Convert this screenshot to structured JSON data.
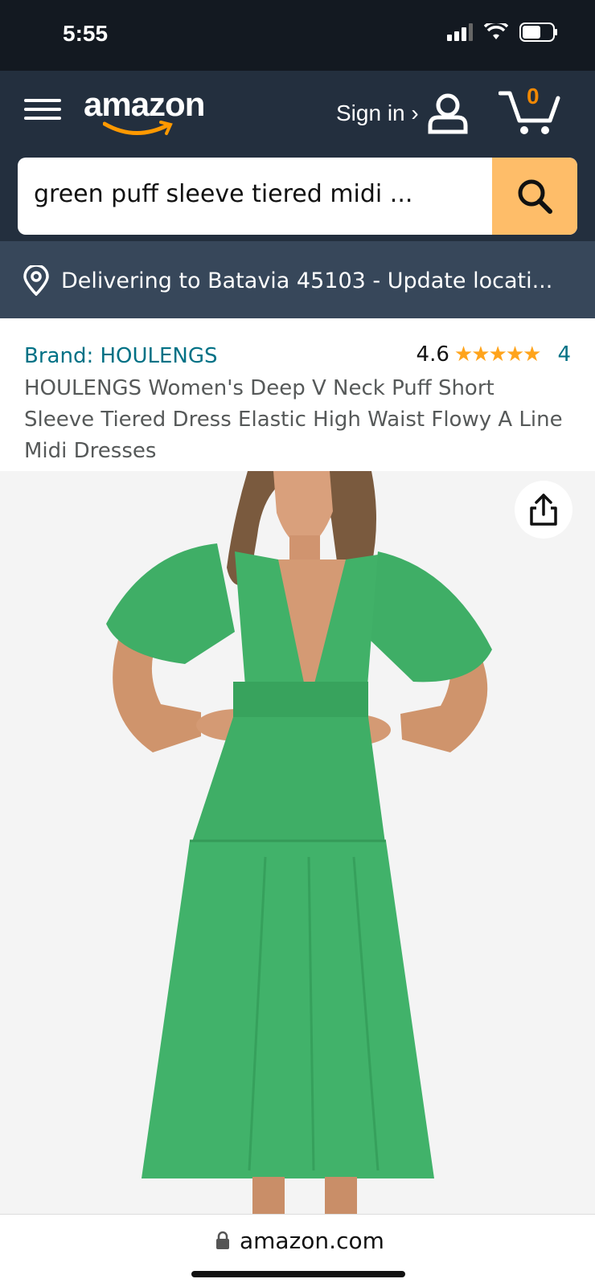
{
  "status": {
    "time": "5:55"
  },
  "header": {
    "logo": "amazon",
    "signin": "Sign in ›",
    "cart_count": "0"
  },
  "search": {
    "query": "green puff sleeve tiered midi ..."
  },
  "delivery": {
    "text": "Delivering to Batavia 45103 - Update locati..."
  },
  "product": {
    "brand": "Brand: HOULENGS",
    "rating": "4.6",
    "stars": "★★★★★",
    "rating_count": "4",
    "title": "HOULENGS Women's Deep V Neck Puff Short Sleeve Tiered Dress Elastic High Waist Flowy A Line Midi Dresses"
  },
  "browser": {
    "url": "amazon.com"
  },
  "colors": {
    "header_bg": "#232f3e",
    "status_bg": "#131921",
    "delivery_bg": "#37475a",
    "search_button": "#febd69",
    "link": "#007185",
    "star": "#ffa41c",
    "dress": "#3fae66"
  }
}
